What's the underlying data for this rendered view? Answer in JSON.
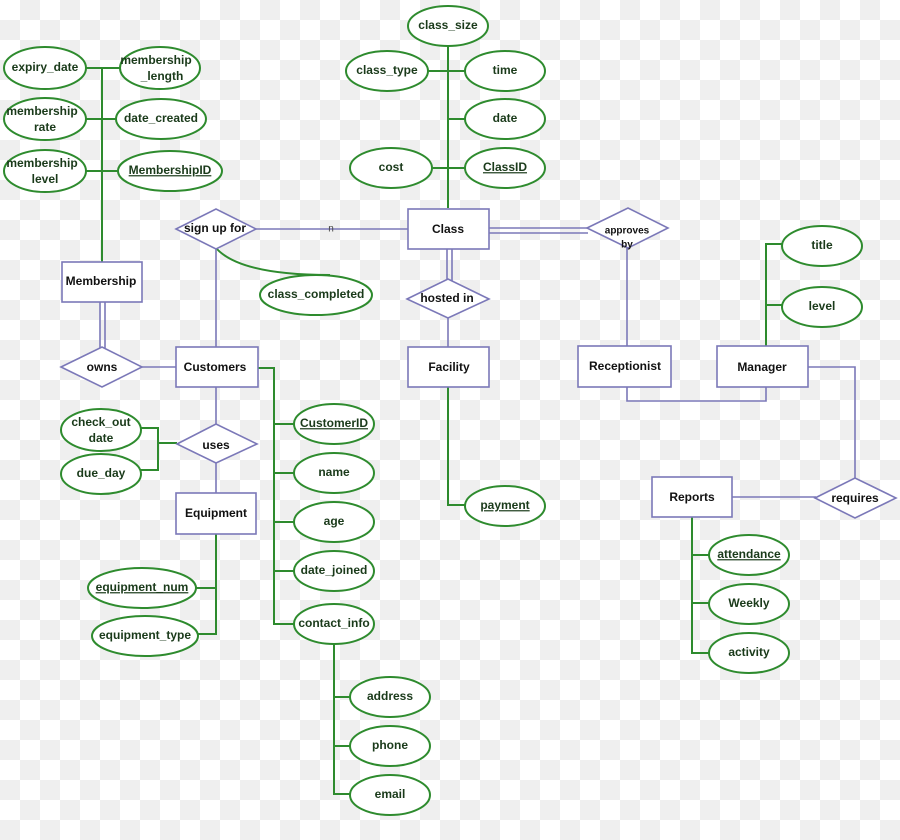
{
  "diagram": {
    "type": "ER diagram",
    "colors": {
      "entity_stroke": "#7b78b8",
      "relationship_stroke": "#7b78b8",
      "attribute_stroke": "#2e8b2e",
      "text": "#111111"
    },
    "entities": {
      "membership": "Membership",
      "customers": "Customers",
      "equipment": "Equipment",
      "class": "Class",
      "facility": "Facility",
      "receptionist": "Receptionist",
      "manager": "Manager",
      "reports": "Reports"
    },
    "relationships": {
      "sign_up_for": "sign up for",
      "owns": "owns",
      "uses": "uses",
      "hosted_in": "hosted in",
      "approves_by_1": "approves",
      "approves_by_2": "by",
      "requires": "requires"
    },
    "cardinalities": {
      "sign_up_class": "n"
    },
    "attributes": {
      "membership": {
        "expiry_date": "expiry_date",
        "membership_length_1": "membership",
        "membership_length_2": "_length",
        "membership_rate_1": "membership",
        "membership_rate_2": "rate",
        "date_created": "date_created",
        "membership_level_1": "membership",
        "membership_level_2": "level",
        "membership_id": "MembershipID"
      },
      "class": {
        "class_size": "class_size",
        "class_type": "class_type",
        "time": "time",
        "date": "date",
        "cost": "cost",
        "class_id": "ClassID"
      },
      "sign_up_for": {
        "class_completed": "class_completed"
      },
      "uses": {
        "check_out_date_1": "check_out",
        "check_out_date_2": "date",
        "due_day": "due_day"
      },
      "equipment": {
        "equipment_num": "equipment_num",
        "equipment_type": "equipment_type"
      },
      "customers": {
        "customer_id": "CustomerID",
        "name": "name",
        "age": "age",
        "date_joined": "date_joined",
        "contact_info": "contact_info"
      },
      "contact_info": {
        "address": "address",
        "phone": "phone",
        "email": "email"
      },
      "facility": {
        "payment": "payment"
      },
      "manager": {
        "title": "title",
        "level": "level"
      },
      "reports": {
        "attendance": "attendance",
        "weekly": "Weekly",
        "activity": "activity"
      }
    }
  }
}
